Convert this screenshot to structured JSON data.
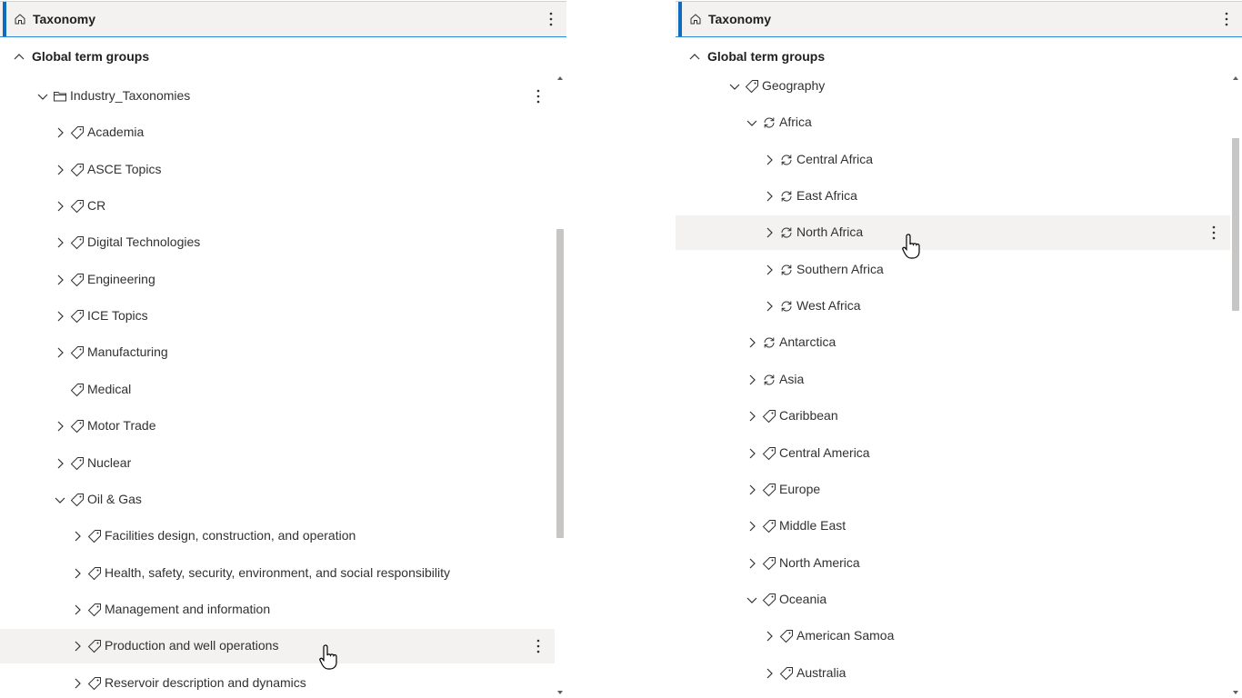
{
  "left_panel": {
    "header": {
      "title": "Taxonomy"
    },
    "group_label": "Global term groups",
    "rows": [
      {
        "label": "Industry_Taxonomies",
        "icon": "folder-icon",
        "chevron": "down",
        "has_more": true
      },
      {
        "label": "Academia",
        "icon": "tag-icon",
        "chevron": "right"
      },
      {
        "label": "ASCE Topics",
        "icon": "tag-icon",
        "chevron": "right"
      },
      {
        "label": "CR",
        "icon": "tag-icon",
        "chevron": "right"
      },
      {
        "label": "Digital Technologies",
        "icon": "tag-icon",
        "chevron": "right"
      },
      {
        "label": "Engineering",
        "icon": "tag-icon",
        "chevron": "right"
      },
      {
        "label": "ICE Topics",
        "icon": "tag-icon",
        "chevron": "right"
      },
      {
        "label": "Manufacturing",
        "icon": "tag-icon",
        "chevron": "right"
      },
      {
        "label": "Medical",
        "icon": "tag-icon",
        "chevron": "none"
      },
      {
        "label": "Motor Trade",
        "icon": "tag-icon",
        "chevron": "right"
      },
      {
        "label": "Nuclear",
        "icon": "tag-icon",
        "chevron": "right"
      },
      {
        "label": "Oil & Gas",
        "icon": "tag-icon",
        "chevron": "down"
      },
      {
        "label": "Facilities design, construction, and operation",
        "icon": "tag-icon",
        "chevron": "right"
      },
      {
        "label": "Health, safety, security, environment, and social responsibility",
        "icon": "tag-icon",
        "chevron": "right"
      },
      {
        "label": "Management and information",
        "icon": "tag-icon",
        "chevron": "right"
      },
      {
        "label": "Production and well operations",
        "icon": "tag-icon",
        "chevron": "right",
        "hovered": true,
        "has_more": true
      },
      {
        "label": "Reservoir description and dynamics",
        "icon": "tag-icon",
        "chevron": "right"
      }
    ]
  },
  "right_panel": {
    "header": {
      "title": "Taxonomy"
    },
    "group_label": "Global term groups",
    "rows": [
      {
        "label": "Geography",
        "icon": "tag-icon",
        "chevron": "down"
      },
      {
        "label": "Africa",
        "icon": "sync-icon",
        "chevron": "down"
      },
      {
        "label": "Central Africa",
        "icon": "sync-icon",
        "chevron": "right"
      },
      {
        "label": "East Africa",
        "icon": "sync-icon",
        "chevron": "right"
      },
      {
        "label": "North Africa",
        "icon": "sync-icon",
        "chevron": "right",
        "hovered": true,
        "has_more": true
      },
      {
        "label": "Southern Africa",
        "icon": "sync-icon",
        "chevron": "right"
      },
      {
        "label": "West Africa",
        "icon": "sync-icon",
        "chevron": "right"
      },
      {
        "label": "Antarctica",
        "icon": "sync-icon",
        "chevron": "right"
      },
      {
        "label": "Asia",
        "icon": "sync-icon",
        "chevron": "right"
      },
      {
        "label": "Caribbean",
        "icon": "tag-icon",
        "chevron": "right"
      },
      {
        "label": "Central America",
        "icon": "tag-icon",
        "chevron": "right"
      },
      {
        "label": "Europe",
        "icon": "tag-icon",
        "chevron": "right"
      },
      {
        "label": "Middle East",
        "icon": "tag-icon",
        "chevron": "right"
      },
      {
        "label": "North America",
        "icon": "tag-icon",
        "chevron": "right"
      },
      {
        "label": "Oceania",
        "icon": "tag-icon",
        "chevron": "down"
      },
      {
        "label": "American Samoa",
        "icon": "tag-icon",
        "chevron": "right"
      },
      {
        "label": "Australia",
        "icon": "tag-icon",
        "chevron": "right"
      }
    ]
  },
  "colors": {
    "accent": "#0f6cbd",
    "header_bg": "#f3f2f1",
    "hover_bg": "#f3f2f1",
    "text": "#323130"
  }
}
